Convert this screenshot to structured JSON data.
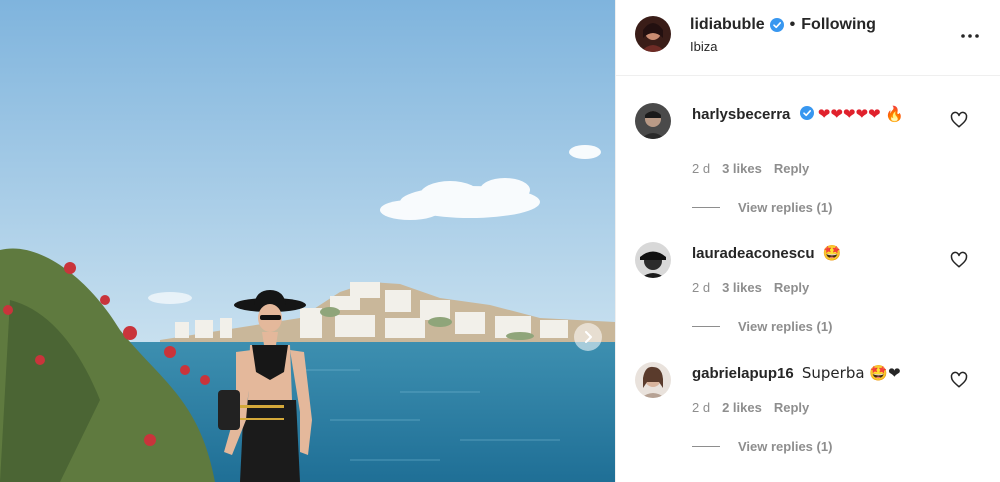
{
  "post": {
    "author": "lidiabuble",
    "separator": "•",
    "follow_state": "Following",
    "location": "Ibiza"
  },
  "colors": {
    "verified": "#3897f0",
    "heart": "#e0212c",
    "muted": "#8e8e8e",
    "text": "#262626"
  },
  "icons": {
    "verified": "verified-badge-icon",
    "more": "more-options-icon",
    "like": "heart-outline-icon",
    "next": "chevron-right-icon"
  },
  "comments": [
    {
      "username": "harlysbecerra",
      "verified": true,
      "text": "❤❤❤❤❤ 🔥",
      "age": "2 d",
      "likes": "3 likes",
      "reply": "Reply",
      "view_replies": "View replies (1)"
    },
    {
      "username": "lauradeaconescu",
      "verified": false,
      "text": "🤩",
      "age": "2 d",
      "likes": "3 likes",
      "reply": "Reply",
      "view_replies": "View replies (1)"
    },
    {
      "username": "gabrielapup16",
      "verified": false,
      "text": "Superba 🤩❤",
      "age": "2 d",
      "likes": "2 likes",
      "reply": "Reply",
      "view_replies": "View replies (1)"
    }
  ]
}
